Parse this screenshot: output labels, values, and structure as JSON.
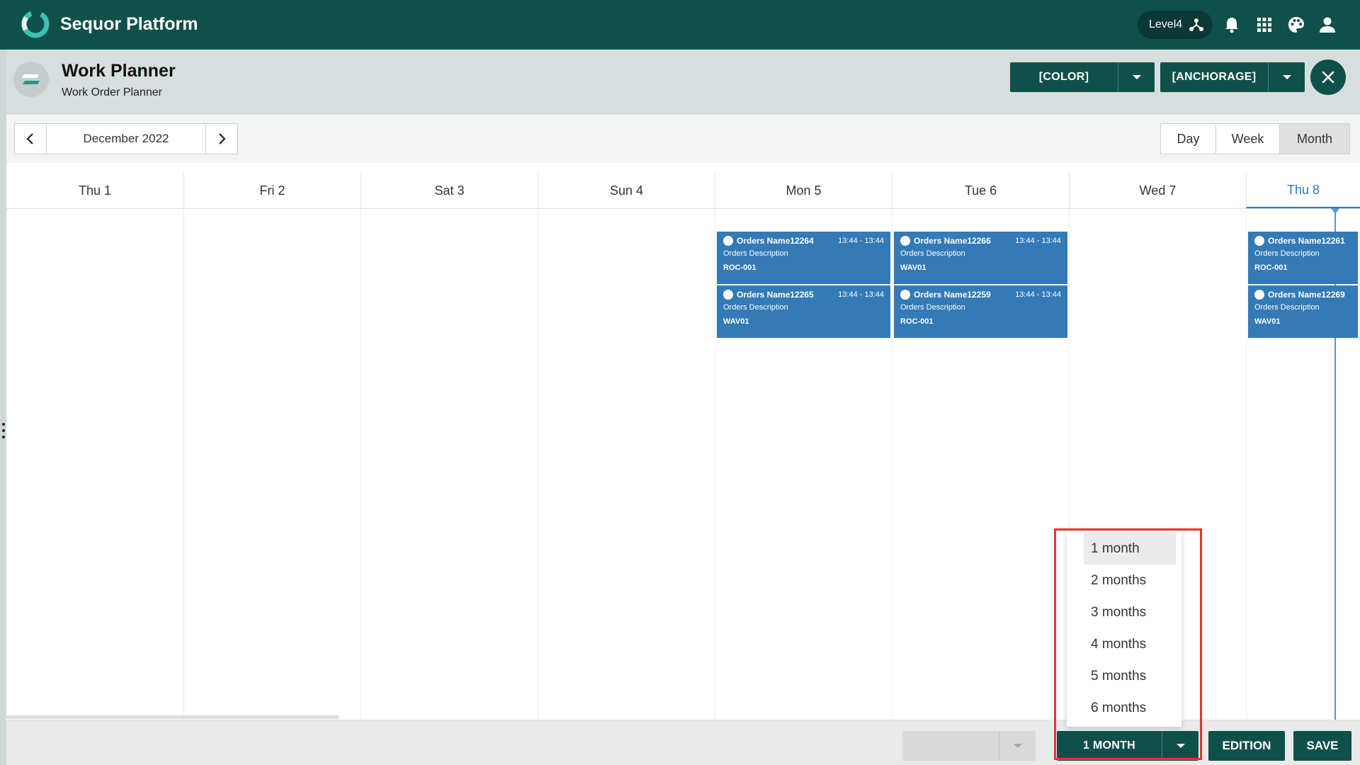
{
  "app": {
    "brand": "Sequor Platform",
    "level_label": "Level4"
  },
  "header": {
    "title": "Work Planner",
    "subtitle": "Work Order Planner",
    "color_button": "[COLOR]",
    "anchorage_button": "[ANCHORAGE]"
  },
  "toolbar": {
    "date_label": "December 2022",
    "views": [
      {
        "label": "Day",
        "active": false
      },
      {
        "label": "Week",
        "active": false
      },
      {
        "label": "Month",
        "active": true
      }
    ]
  },
  "calendar": {
    "days": [
      "Thu 1",
      "Fri 2",
      "Sat 3",
      "Sun 4",
      "Mon 5",
      "Tue 6",
      "Wed 7",
      "Thu 8"
    ],
    "today": "Thu 8",
    "events": [
      {
        "day": "Mon 5",
        "name": "Orders Name12264",
        "time": "13:44 - 13:44",
        "description": "Orders Description",
        "resource": "ROC-001"
      },
      {
        "day": "Mon 5",
        "name": "Orders Name12265",
        "time": "13:44 - 13:44",
        "description": "Orders Description",
        "resource": "WAV01"
      },
      {
        "day": "Tue 6",
        "name": "Orders Name12266",
        "time": "13:44 - 13:44",
        "description": "Orders Description",
        "resource": "WAV01"
      },
      {
        "day": "Tue 6",
        "name": "Orders Name12259",
        "time": "13:44 - 13:44",
        "description": "Orders Description",
        "resource": "ROC-001"
      },
      {
        "day": "Thu 8",
        "name": "Orders Name12261",
        "time": "",
        "description": "Orders Description",
        "resource": "ROC-001"
      },
      {
        "day": "Thu 8",
        "name": "Orders Name12269",
        "time": "",
        "description": "Orders Description",
        "resource": "WAV01"
      }
    ]
  },
  "bottom": {
    "range_button": "1 MONTH",
    "edition_button": "EDITION",
    "save_button": "SAVE",
    "range_menu": [
      "1 month",
      "2 months",
      "3 months",
      "4 months",
      "5 months",
      "6 months"
    ],
    "range_selected": "1 month"
  },
  "colors": {
    "brand_dark": "#0f514a",
    "event_blue": "#337ab7",
    "today_blue": "#2f78b7",
    "highlight_red": "#e8322d"
  }
}
